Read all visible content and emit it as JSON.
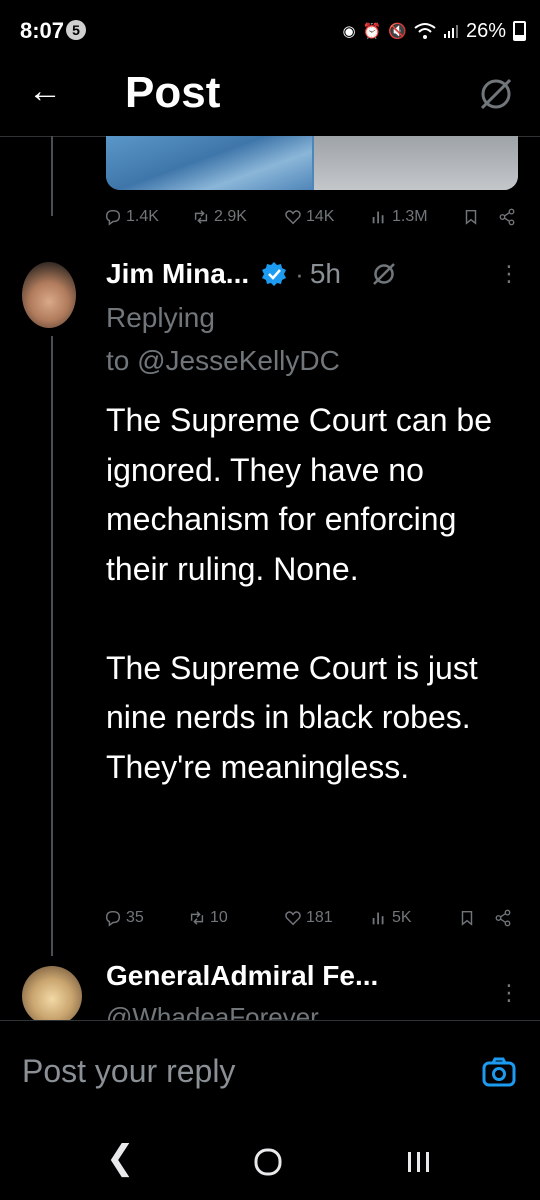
{
  "status_bar": {
    "time": "8:07",
    "notification_count": "5",
    "battery": "26%",
    "battery_level": 0.26,
    "icons": [
      "alarm-icon",
      "alarm-clock-icon",
      "mute-icon",
      "wifi-icon",
      "signal-icon",
      "battery-icon"
    ]
  },
  "header": {
    "title": "Post",
    "back_icon": "back-arrow-icon",
    "grok_icon": "grok-icon"
  },
  "original_post": {
    "stats": {
      "replies": "1.4K",
      "reposts": "2.9K",
      "likes": "14K",
      "views": "1.3M"
    }
  },
  "reply": {
    "name": "Jim Mina...",
    "age": "5h",
    "replying_label": "Replying",
    "replying_to": "to @JesseKellyDC",
    "text": "The Supreme Court can be ignored. They have no mechanism for enforcing their ruling. None.\n\nThe Supreme Court is just nine nerds in black robes. They're meaningless.",
    "stats": {
      "replies": "35",
      "reposts": "10",
      "likes": "181",
      "views": "5K"
    },
    "verified_color": "#1d9bf0"
  },
  "next_reply": {
    "name": "GeneralAdmiral Fe...",
    "handle": "@WhadeaForever"
  },
  "composer": {
    "placeholder": "Post your reply"
  },
  "colors": {
    "background": "#000000",
    "accent": "#1d9bf0",
    "secondary_text": "#71767b"
  }
}
